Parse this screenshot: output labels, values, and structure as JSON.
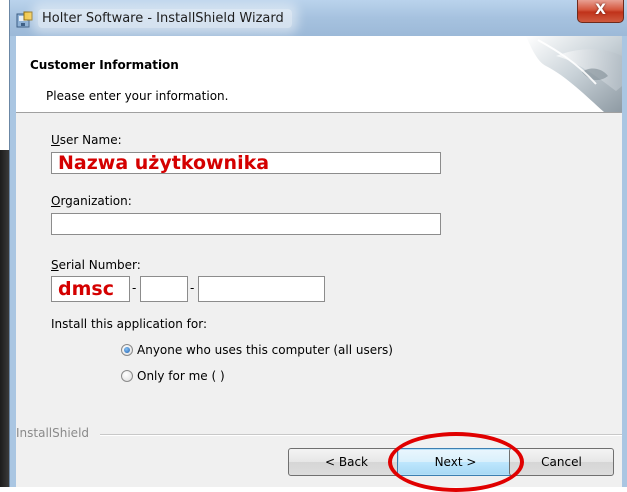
{
  "window": {
    "title": "Holter Software - InstallShield Wizard",
    "close_glyph": "X"
  },
  "header": {
    "title": "Customer Information",
    "subtitle": "Please enter your information."
  },
  "form": {
    "user_name": {
      "label_underline": "U",
      "label_rest": "ser Name:",
      "value": "Nazwa użytkownika"
    },
    "organization": {
      "label_underline": "O",
      "label_rest": "rganization:",
      "value": ""
    },
    "serial": {
      "label_underline": "S",
      "label_rest": "erial Number:",
      "part1": "dmsc",
      "part2": "",
      "part3": "",
      "part4": "",
      "separator": "-"
    },
    "install_for": {
      "label": "Install this application for:",
      "options": [
        {
          "label": "Anyone who uses this computer (all users)",
          "selected": true
        },
        {
          "label": "Only for me ( )",
          "selected": false
        }
      ]
    }
  },
  "footer": {
    "brand": "InstallShield",
    "back_label": "< Back",
    "next_label": "Next >",
    "cancel_label": "Cancel"
  },
  "colors": {
    "highlight_red": "#d40000",
    "annotation_red": "#e00000",
    "titlebar": "#aac6e2"
  },
  "icons": {
    "app": "installer-icon",
    "close": "close-icon",
    "radio_on": "radio-selected-icon",
    "radio_off": "radio-unselected-icon"
  }
}
